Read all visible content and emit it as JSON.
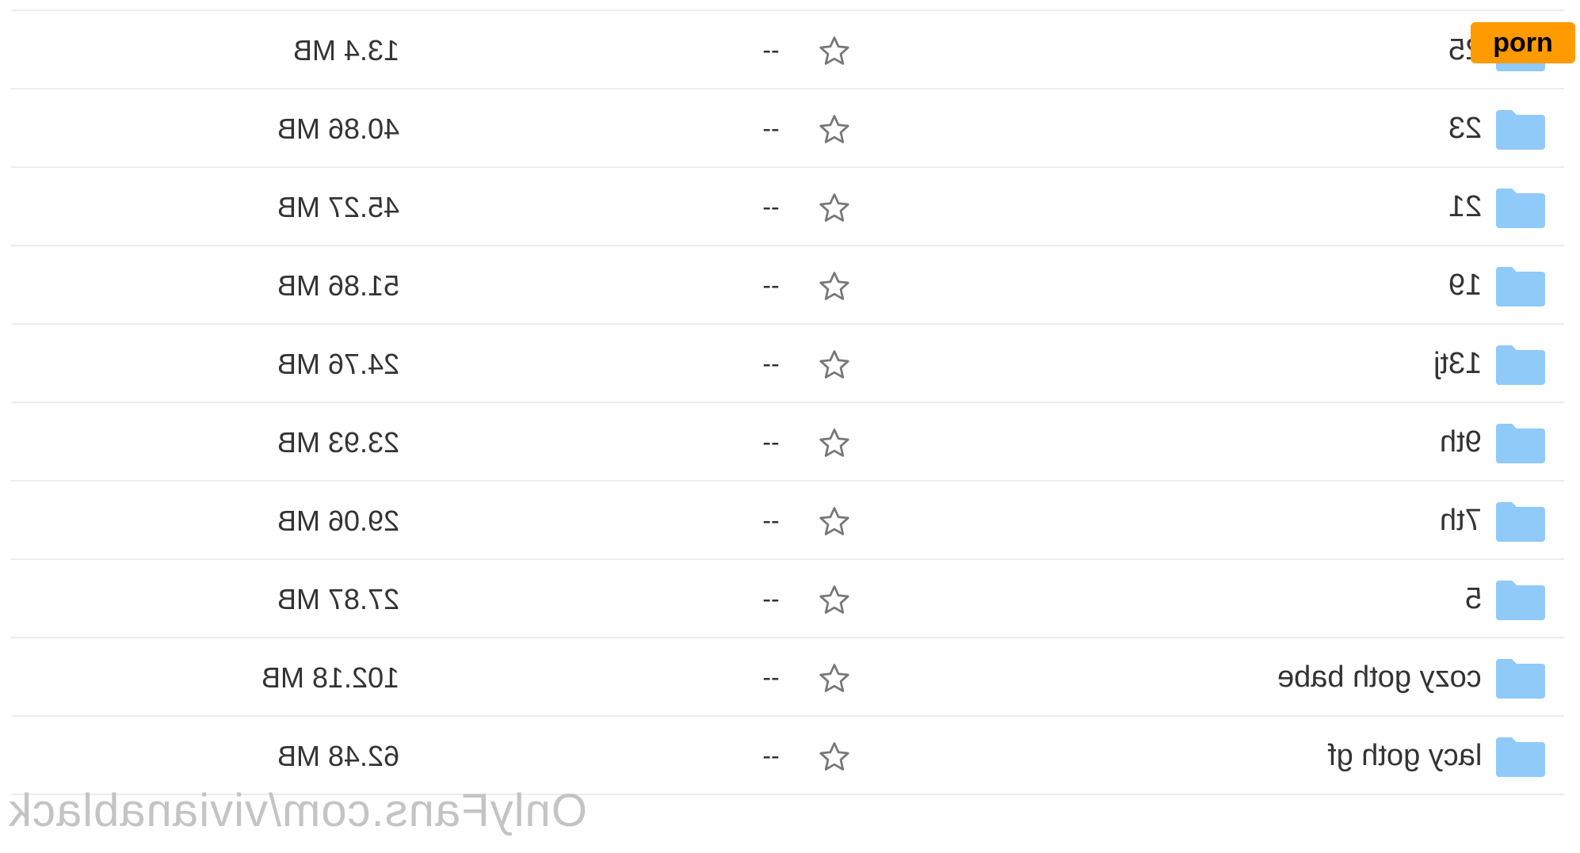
{
  "colors": {
    "folder": "#90caf9",
    "divider": "#ececec",
    "badge_bg": "#ff9a00",
    "watermark": "#c4c4c4"
  },
  "badge": {
    "text": "porn"
  },
  "watermark": {
    "text": "OnlyFans.com/vivianablack"
  },
  "files": [
    {
      "name": "25",
      "modified": "--",
      "size": "13.4 MB",
      "icon": "folder-icon",
      "starred": false
    },
    {
      "name": "23",
      "modified": "--",
      "size": "40.86 MB",
      "icon": "folder-icon",
      "starred": false
    },
    {
      "name": "21",
      "modified": "--",
      "size": "45.27 MB",
      "icon": "folder-icon",
      "starred": false
    },
    {
      "name": "19",
      "modified": "--",
      "size": "51.86 MB",
      "icon": "folder-icon",
      "starred": false
    },
    {
      "name": "13tj",
      "modified": "--",
      "size": "24.76 MB",
      "icon": "folder-icon",
      "starred": false
    },
    {
      "name": "9th",
      "modified": "--",
      "size": "23.93 MB",
      "icon": "folder-icon",
      "starred": false
    },
    {
      "name": "7th",
      "modified": "--",
      "size": "29.06 MB",
      "icon": "folder-icon",
      "starred": false
    },
    {
      "name": "5",
      "modified": "--",
      "size": "27.87 MB",
      "icon": "folder-icon",
      "starred": false
    },
    {
      "name": "cozy goth babe",
      "modified": "--",
      "size": "102.18 MB",
      "icon": "folder-icon",
      "starred": false
    },
    {
      "name": "lacy goth gf",
      "modified": "--",
      "size": "62.48 MB",
      "icon": "folder-icon",
      "starred": false
    }
  ]
}
